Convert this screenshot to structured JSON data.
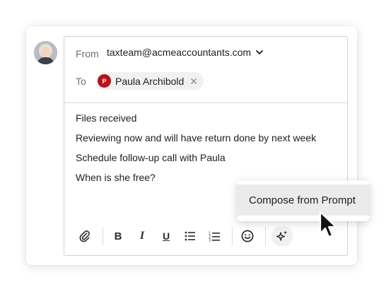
{
  "header": {
    "from_label": "From",
    "from_address": "taxteam@acmeaccountants.com",
    "to_label": "To",
    "recipient": {
      "name": "Paula Archibold",
      "initial": "P",
      "color": "#b6121b"
    }
  },
  "body": {
    "lines": [
      "Files received",
      "Reviewing now and will have return done by next week",
      "Schedule follow-up call with Paula",
      "When is she free?"
    ]
  },
  "toolbar": {
    "buttons": [
      {
        "icon": "paperclip-icon"
      },
      {
        "label": "B",
        "icon": "bold-icon"
      },
      {
        "label": "I",
        "icon": "italic-icon"
      },
      {
        "label": "U",
        "icon": "underline-icon"
      },
      {
        "icon": "bullet-list-icon"
      },
      {
        "icon": "numbered-list-icon"
      },
      {
        "icon": "emoji-icon"
      },
      {
        "icon": "sparkle-icon"
      }
    ]
  },
  "popup": {
    "item_label": "Compose from Prompt"
  }
}
